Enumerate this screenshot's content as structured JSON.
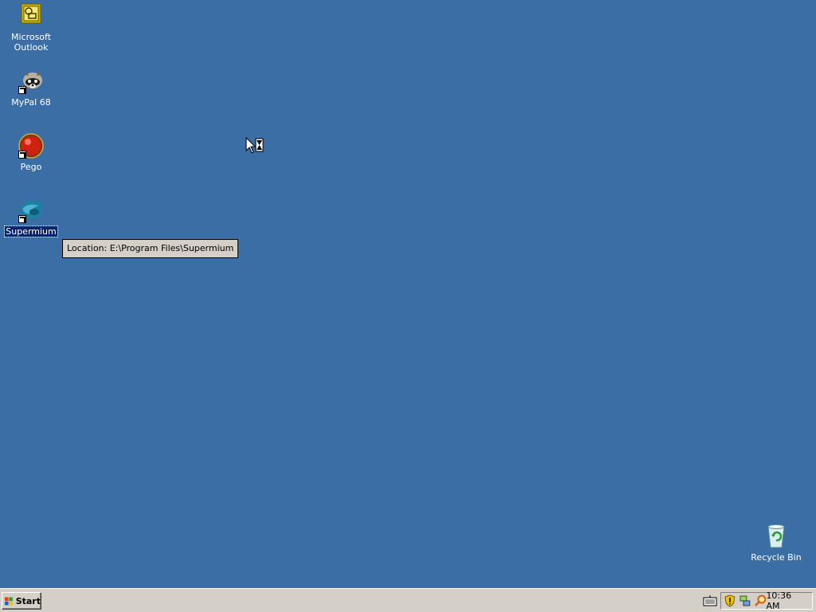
{
  "desktop": {
    "icons": [
      {
        "label_line1": "Microsoft",
        "label_line2": "Outlook",
        "icon": "outlook-icon"
      },
      {
        "label": "MyPal 68",
        "icon": "mypal-raccoon-icon"
      },
      {
        "label": "Pego",
        "icon": "pego-red-ball-icon"
      },
      {
        "label": "Supermium",
        "icon": "supermium-icon",
        "selected": true
      },
      {
        "label": "Recycle Bin",
        "icon": "recycle-bin-icon"
      }
    ],
    "tooltip": "Location: E:\\Program Files\\Supermium",
    "background_color": "#3a6ea5"
  },
  "taskbar": {
    "start_label": "Start",
    "clock": "10:36 AM",
    "tray_icons": [
      "keyboard-icon",
      "security-shield-icon",
      "network-icon",
      "search-magnifier-icon"
    ]
  }
}
